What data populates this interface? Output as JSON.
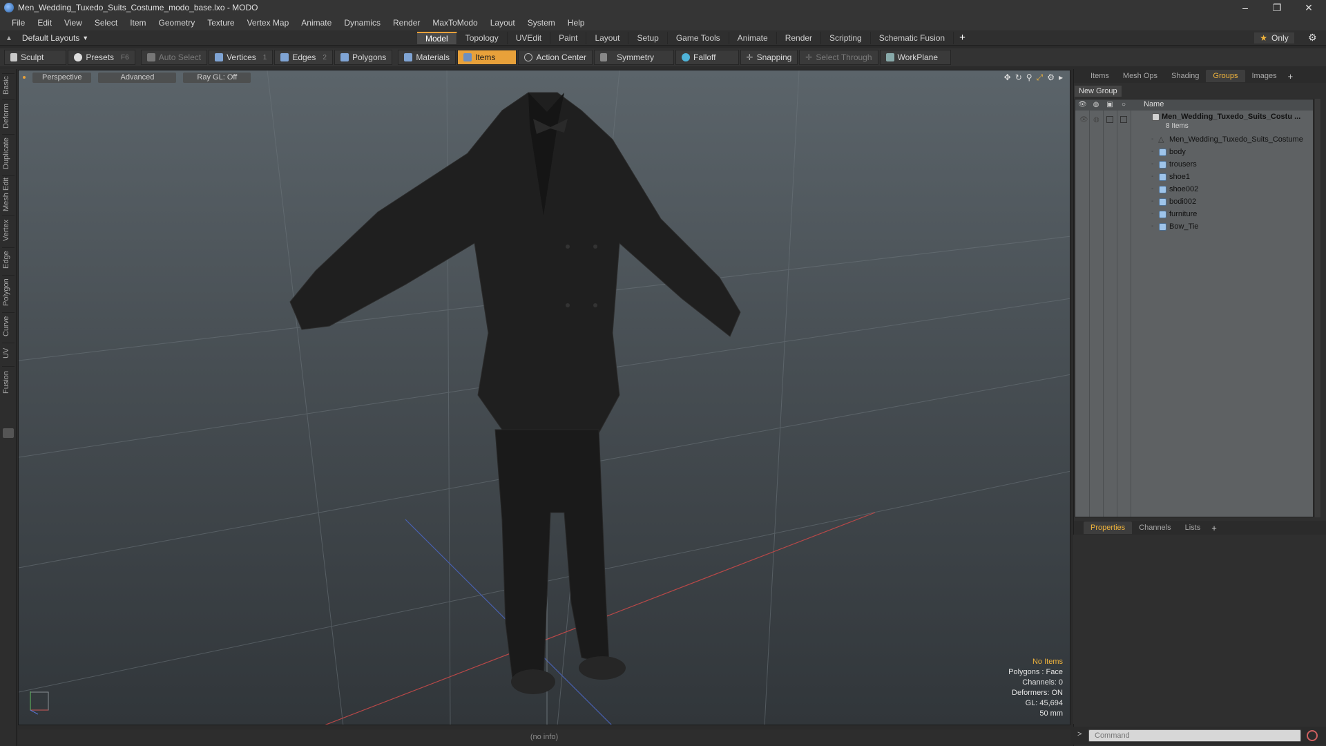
{
  "window": {
    "title": "Men_Wedding_Tuxedo_Suits_Costume_modo_base.lxo - MODO",
    "minimize": "–",
    "restore": "❐",
    "close": "✕"
  },
  "menu": [
    "File",
    "Edit",
    "View",
    "Select",
    "Item",
    "Geometry",
    "Texture",
    "Vertex Map",
    "Animate",
    "Dynamics",
    "Render",
    "MaxToModo",
    "Layout",
    "System",
    "Help"
  ],
  "layout_selector": "Default Layouts",
  "tabs": [
    "Model",
    "Topology",
    "UVEdit",
    "Paint",
    "Layout",
    "Setup",
    "Game Tools",
    "Animate",
    "Render",
    "Scripting",
    "Schematic Fusion"
  ],
  "active_tab": "Model",
  "only_label": "Only",
  "toolbar": {
    "sculpt": "Sculpt",
    "presets": "Presets",
    "presets_key": "F6",
    "auto_select": "Auto Select",
    "vertices": "Vertices",
    "vertices_key": "1",
    "edges": "Edges",
    "edges_key": "2",
    "polygons": "Polygons",
    "materials": "Materials",
    "items": "Items",
    "action_center": "Action Center",
    "symmetry": "Symmetry",
    "falloff": "Falloff",
    "snapping": "Snapping",
    "select_through": "Select Through",
    "workplane": "WorkPlane"
  },
  "left_tabs": [
    "Basic",
    "Deform",
    "Duplicate",
    "Mesh Edit",
    "Vertex",
    "Edge",
    "Polygon",
    "Curve",
    "UV",
    "Fusion"
  ],
  "viewport": {
    "view": "Perspective",
    "shading": "Advanced",
    "raygl": "Ray GL: Off",
    "info": {
      "items": "No Items",
      "polygons": "Polygons : Face",
      "channels": "Channels: 0",
      "deformers": "Deformers: ON",
      "gl": "GL: 45,694",
      "size": "50 mm"
    }
  },
  "status": "(no info)",
  "right_panel": {
    "tabs": [
      "Items",
      "Mesh Ops",
      "Shading",
      "Groups",
      "Images"
    ],
    "active_tab": "Groups",
    "new_group": "New Group",
    "name_header": "Name",
    "group_name": "Men_Wedding_Tuxedo_Suits_Costu ...",
    "group_count": "8 Items",
    "items": [
      "Men_Wedding_Tuxedo_Suits_Costume",
      "body",
      "trousers",
      "shoe1",
      "shoe002",
      "bodi002",
      "furniture",
      "Bow_Tie"
    ],
    "bottom_tabs": [
      "Properties",
      "Channels",
      "Lists"
    ],
    "bottom_active": "Properties",
    "command_placeholder": "Command",
    "command_prompt": ">"
  },
  "colors": {
    "accent": "#e8a13a",
    "tab_active_text": "#f0b43c"
  }
}
